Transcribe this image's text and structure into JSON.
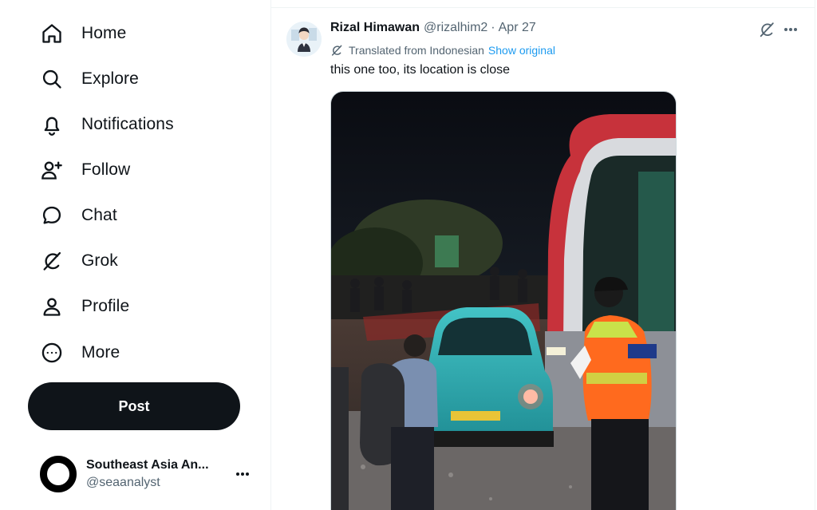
{
  "sidebar": {
    "items": [
      {
        "label": "Home",
        "icon": "home-icon"
      },
      {
        "label": "Explore",
        "icon": "search-icon"
      },
      {
        "label": "Notifications",
        "icon": "bell-icon"
      },
      {
        "label": "Follow",
        "icon": "follow-icon"
      },
      {
        "label": "Chat",
        "icon": "chat-icon"
      },
      {
        "label": "Grok",
        "icon": "grok-icon"
      },
      {
        "label": "Profile",
        "icon": "profile-icon"
      },
      {
        "label": "More",
        "icon": "more-circle-icon"
      }
    ],
    "post_label": "Post",
    "account": {
      "name": "Southeast Asia An...",
      "handle": "@seaanalyst"
    }
  },
  "tweet": {
    "author_name": "Rizal Himawan",
    "author_handle": "@rizalhim2",
    "separator": "·",
    "date": "Apr 27",
    "translated_label": "Translated from Indonesian",
    "show_original_label": "Show original",
    "text": "this one too, its location is close",
    "media_alt_icon": "photo"
  },
  "colors": {
    "text_primary": "#0f1419",
    "text_secondary": "#536471",
    "link": "#1d9bf0",
    "post_button_bg": "#0f1419",
    "border": "#eff3f4"
  }
}
